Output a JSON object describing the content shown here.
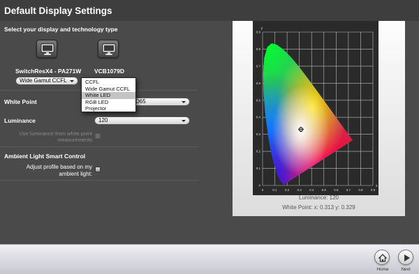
{
  "window": {
    "title": "Default Display Settings"
  },
  "section": {
    "subtitle": "Select your display and technology type"
  },
  "displays": [
    {
      "name": "SwitchResX4 - PA271W",
      "technology": "Wide Gamut CCFL",
      "icon": "monitor-icon"
    },
    {
      "name": "VCB1079D",
      "icon": "monitor-icon"
    }
  ],
  "tech_dropdown": {
    "options": [
      "CCFL",
      "Wide Gamut CCFL",
      "White LED",
      "RGB LED",
      "Projector"
    ],
    "selected": "White LED"
  },
  "white_point": {
    "label": "White Point",
    "value": "D65"
  },
  "luminance": {
    "label": "Luminance",
    "value": "120",
    "checkbox_label": "Use luminance from white point measurements"
  },
  "ambient": {
    "title": "Ambient Light Smart Control",
    "checkbox_label": "Adjust profile based on my ambient light:"
  },
  "chart_caption": {
    "luminance": "Luminance: 120",
    "white_point": "White Point: x: 0.313  y: 0.329"
  },
  "footer": {
    "home": {
      "label": "Home",
      "icon": "home-icon"
    },
    "next": {
      "label": "Next",
      "icon": "play-icon"
    }
  },
  "chart_data": {
    "type": "scatter",
    "x_ticks": [
      "0",
      "0.1",
      "0.2",
      "0.3",
      "0.4",
      "0.5",
      "0.6",
      "0.7",
      "0.8",
      "0.9"
    ],
    "y_ticks": [
      "0",
      "0.1",
      "0.2",
      "0.3",
      "0.4",
      "0.5",
      "0.6",
      "0.7",
      "0.8",
      "0.9"
    ],
    "xlim": [
      0,
      0.9
    ],
    "ylim": [
      0,
      0.9
    ],
    "xlabel": "x",
    "ylabel": "y",
    "white_point": {
      "x": 0.313,
      "y": 0.329
    },
    "background": "#2a2a2a"
  }
}
